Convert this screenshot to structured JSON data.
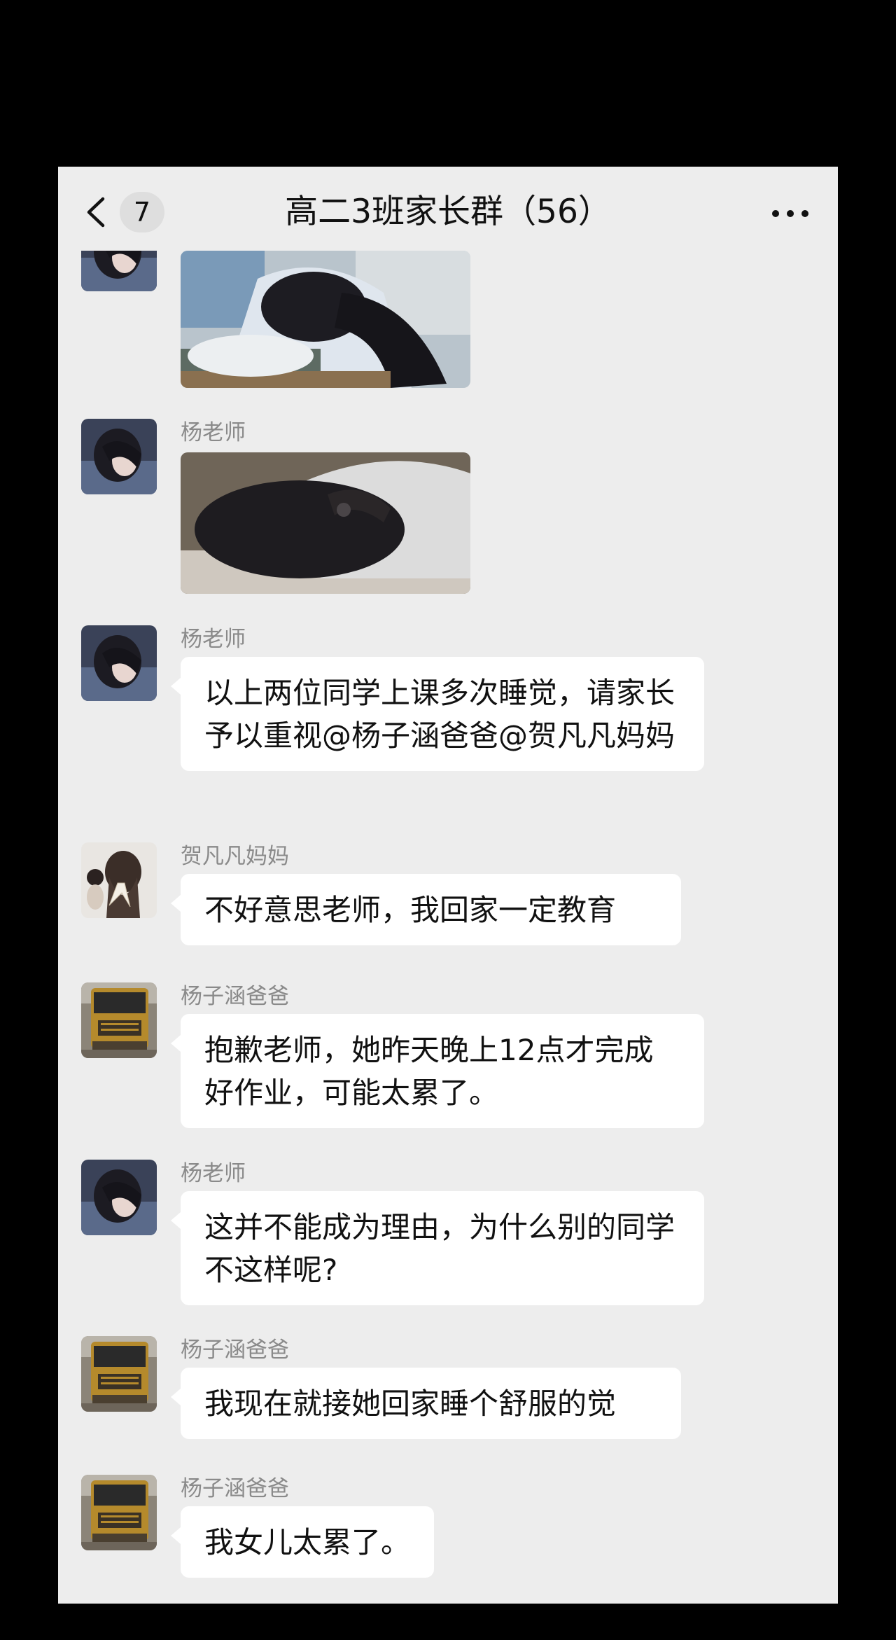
{
  "header": {
    "back_icon": "chevron-left-icon",
    "unread_count": "7",
    "title": "高二3班家长群（56）",
    "more_icon": "more-dots-icon"
  },
  "messages": [
    {
      "type": "image",
      "sender": "",
      "avatar": "girl-sleeping-avatar",
      "image": "student-sleeping-on-desk-photo"
    },
    {
      "type": "image",
      "sender": "杨老师",
      "avatar": "girl-sleeping-avatar",
      "image": "student-head-down-photo"
    },
    {
      "type": "text",
      "sender": "杨老师",
      "avatar": "girl-sleeping-avatar",
      "text": "以上两位同学上课多次睡觉，请家长予以重视@杨子涵爸爸@贺凡凡妈妈"
    },
    {
      "type": "text",
      "sender": "贺凡凡妈妈",
      "avatar": "girl-bow-avatar",
      "text": "不好意思老师，我回家一定教育"
    },
    {
      "type": "text",
      "sender": "杨子涵爸爸",
      "avatar": "truck-avatar",
      "text": "抱歉老师，她昨天晚上12点才完成好作业，可能太累了。"
    },
    {
      "type": "text",
      "sender": "杨老师",
      "avatar": "girl-sleeping-avatar",
      "text": "这并不能成为理由，为什么别的同学不这样呢?"
    },
    {
      "type": "text",
      "sender": "杨子涵爸爸",
      "avatar": "truck-avatar",
      "text": "我现在就接她回家睡个舒服的觉"
    },
    {
      "type": "text",
      "sender": "杨子涵爸爸",
      "avatar": "truck-avatar",
      "text": "我女儿太累了。"
    }
  ],
  "colors": {
    "background": "#ededed",
    "bubble": "#ffffff",
    "sender_name": "#8a8a8a",
    "text": "#111111",
    "outer": "#000000"
  }
}
